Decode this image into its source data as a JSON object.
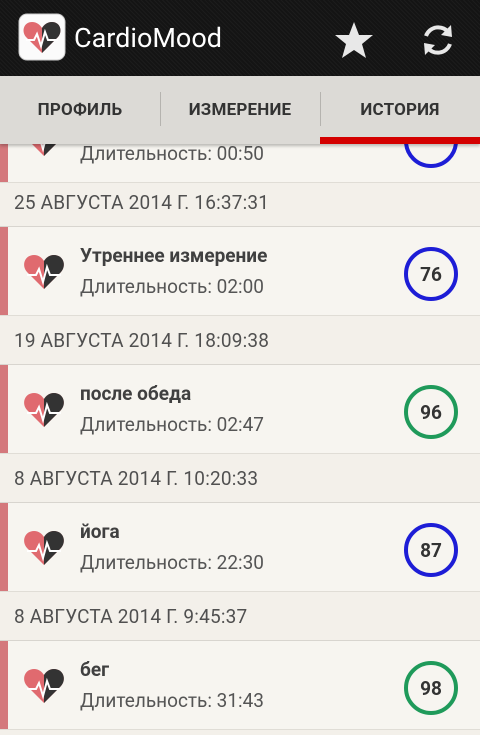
{
  "app": {
    "title": "CardioMood"
  },
  "toolbar": {
    "favorite_icon": "star-icon",
    "sync_icon": "refresh-icon"
  },
  "tabs": [
    {
      "label": "ПРОФИЛЬ",
      "active": false
    },
    {
      "label": "ИЗМЕРЕНИЕ",
      "active": false
    },
    {
      "label": "ИСТОРИЯ",
      "active": true
    }
  ],
  "colors": {
    "accent": "#d40000",
    "blue_ring": "#1d1dd6",
    "green_ring": "#1f9a5a",
    "item_bar": "#d4787c"
  },
  "history": {
    "partial_item": {
      "duration": "Длительность: 00:50"
    },
    "groups": [
      {
        "date": "25 АВГУСТА 2014 Г. 16:37:31",
        "item": {
          "name": "Утреннее измерение",
          "duration": "Длительность: 02:00",
          "value": "76",
          "ring": "blue"
        }
      },
      {
        "date": "19 АВГУСТА 2014 Г. 18:09:38",
        "item": {
          "name": "после обеда",
          "duration": "Длительность: 02:47",
          "value": "96",
          "ring": "green"
        }
      },
      {
        "date": "8 АВГУСТА 2014 Г. 10:20:33",
        "item": {
          "name": "йога",
          "duration": "Длительность: 22:30",
          "value": "87",
          "ring": "blue"
        }
      },
      {
        "date": "8 АВГУСТА 2014 Г. 9:45:37",
        "item": {
          "name": "бег",
          "duration": "Длительность: 31:43",
          "value": "98",
          "ring": "green"
        }
      }
    ]
  }
}
